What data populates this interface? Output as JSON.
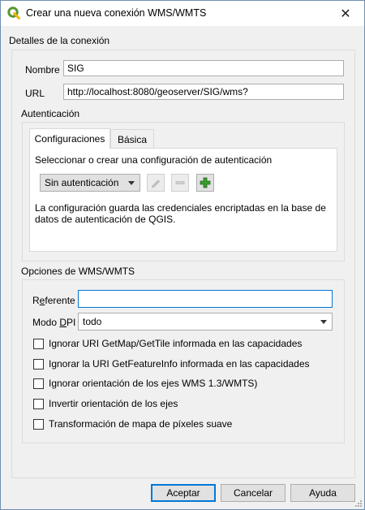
{
  "window": {
    "title": "Crear una nueva conexión WMS/WMTS",
    "close_symbol": "✕"
  },
  "connection": {
    "section_title": "Detalles de la conexión",
    "name_label": "Nombre",
    "name_value": "SIG",
    "url_label": "URL",
    "url_value": "http://localhost:8080/geoserver/SIG/wms?"
  },
  "auth": {
    "section_title": "Autenticación",
    "tabs": [
      {
        "label": "Configuraciones",
        "active": true
      },
      {
        "label": "Básica",
        "active": false
      }
    ],
    "config_prompt": "Seleccionar o crear una configuración de autenticación",
    "config_select_value": "Sin autenticación",
    "info_text": "La configuración guarda las credenciales encriptadas en la base de datos de autenticación de QGIS."
  },
  "wms_options": {
    "section_title": "Opciones de WMS/WMTS",
    "referer_label_pre": "R",
    "referer_label_underlined": "e",
    "referer_label_post": "ferente",
    "referer_value": "",
    "dpi_label_pre": "Modo ",
    "dpi_label_underlined": "D",
    "dpi_label_post": "PI",
    "dpi_value": "todo",
    "checkboxes": [
      {
        "label": "Ignorar URI GetMap/GetTile informada en las capacidades",
        "checked": false
      },
      {
        "label": "Ignorar la URI GetFeatureInfo informada en las capacidades",
        "checked": false
      },
      {
        "label": "Ignorar orientación de los ejes WMS 1.3/WMTS)",
        "checked": false
      },
      {
        "label": "Invertir orientación de los ejes",
        "checked": false
      },
      {
        "label": "Transformación de mapa de píxeles suave",
        "checked": false
      }
    ]
  },
  "buttons": {
    "accept": "Aceptar",
    "cancel": "Cancelar",
    "help": "Ayuda"
  },
  "colors": {
    "accent": "#0078d7",
    "qgis_green": "#589632",
    "add_green": "#3a9c2f"
  }
}
